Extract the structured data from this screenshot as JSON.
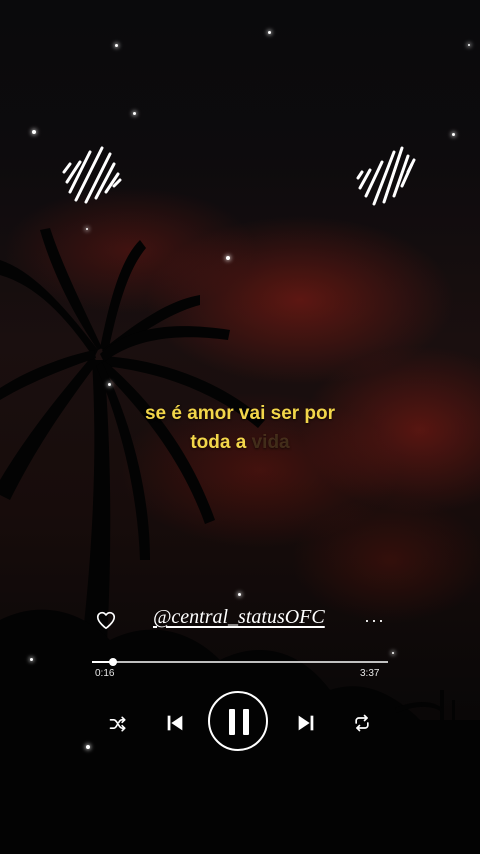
{
  "lyrics": {
    "line1": "se é amor vai ser por",
    "line2_active": "toda a",
    "line2_upcoming": "vida"
  },
  "player": {
    "handle": "@central_statusOFC",
    "more_label": "···",
    "elapsed": "0:16",
    "total": "3:37",
    "progress_fraction": 0.072
  },
  "icons": {
    "like": "heart-icon",
    "shuffle": "shuffle-icon",
    "previous": "skip-previous-icon",
    "play_pause": "pause-icon",
    "next": "skip-next-icon",
    "repeat": "repeat-icon",
    "decor": "sound-wave-icon"
  },
  "colors": {
    "lyric": "#f2d64a",
    "text": "#ffffff",
    "sky_red": "#8c1e14"
  }
}
